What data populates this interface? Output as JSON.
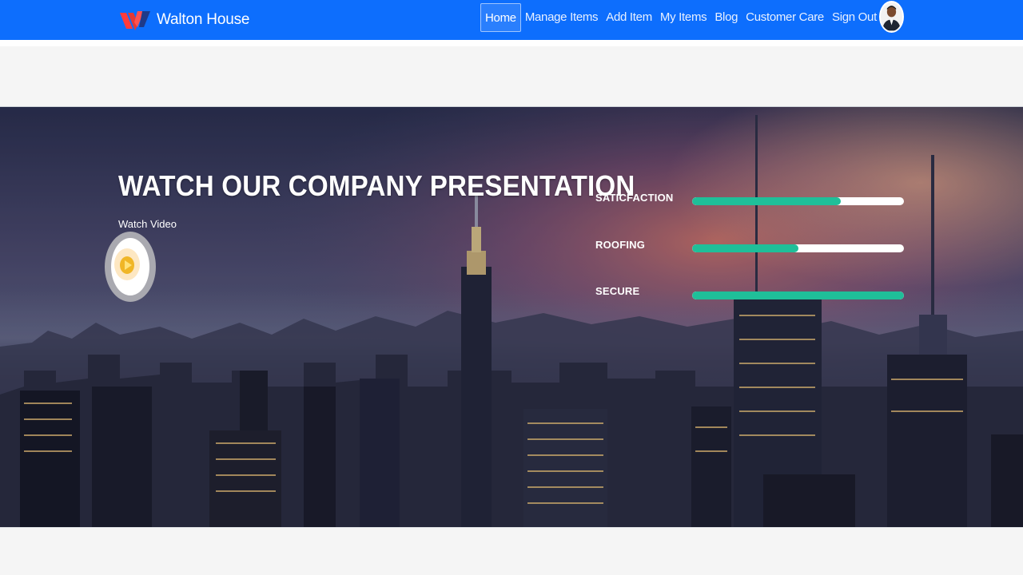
{
  "header": {
    "brand_name": "Walton House",
    "logo_icon": "walton-logo-icon",
    "nav_items": [
      "Home",
      "Manage Items",
      "Add Item",
      "My Items",
      "Blog",
      "Customer Care",
      "Sign Out"
    ],
    "active_item": "Home",
    "avatar_icon": "user-avatar",
    "bg_color": "#0d6efd"
  },
  "hero": {
    "title": "WATCH OUR COMPANY PRESENTATION",
    "watch_label": "Watch Video",
    "play_icon": "play-icon",
    "skills": [
      {
        "label": "SATICFACTION",
        "percent": 70
      },
      {
        "label": "ROOFING",
        "percent": 50
      },
      {
        "label": "SECURE",
        "percent": 100
      }
    ],
    "bar_color": "#1fbf99"
  }
}
